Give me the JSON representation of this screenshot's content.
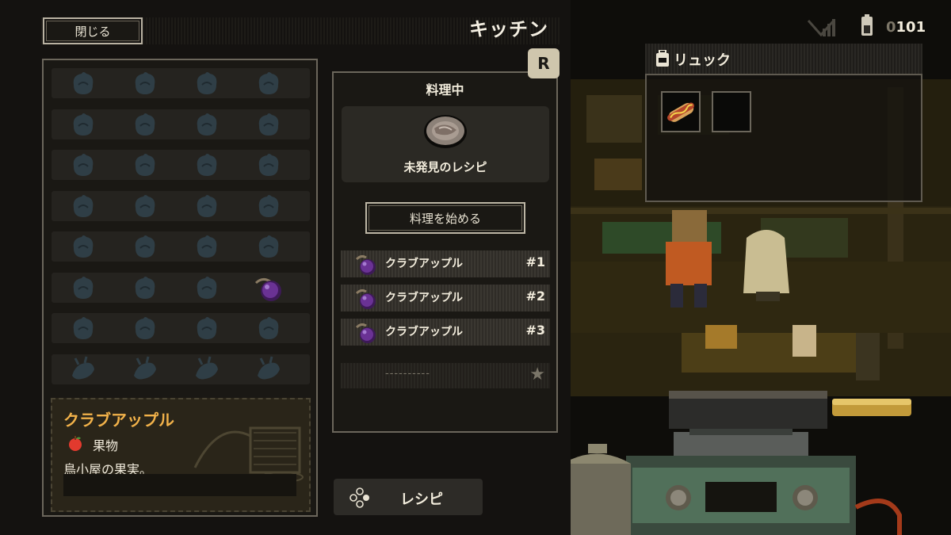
{
  "header": {
    "close_label": "閉じる",
    "title": "キッチン"
  },
  "inventory": {
    "rows": 8,
    "cols": 4,
    "filled_slot": {
      "row": 5,
      "col": 3,
      "item": "クラブアップル",
      "icon": "crab-apple-icon"
    }
  },
  "description": {
    "name": "クラブアップル",
    "category_icon": "apple-icon",
    "category": "果物",
    "text": "鳥小屋の果実。"
  },
  "cooking": {
    "badge": "R",
    "heading": "料理中",
    "recipe_name": "未発見のレシピ",
    "start_label": "料理を始める",
    "ingredients": [
      {
        "name": "クラブアップル",
        "number": "#1"
      },
      {
        "name": "クラブアップル",
        "number": "#2"
      },
      {
        "name": "クラブアップル",
        "number": "#3"
      }
    ],
    "empty_slot_dashes": "----------",
    "empty_slot_star": "★"
  },
  "recipe_button": {
    "label": "レシピ"
  },
  "hud": {
    "money_dim": "0",
    "money": "101"
  },
  "backpack": {
    "title": "リュック",
    "items": [
      "hotdog-icon",
      ""
    ]
  },
  "colors": {
    "accent_orange": "#f2b24a",
    "panel_border": "#6b665b",
    "apple_red": "#e23a2e",
    "crab_apple_purple": "#5a2a7a"
  }
}
